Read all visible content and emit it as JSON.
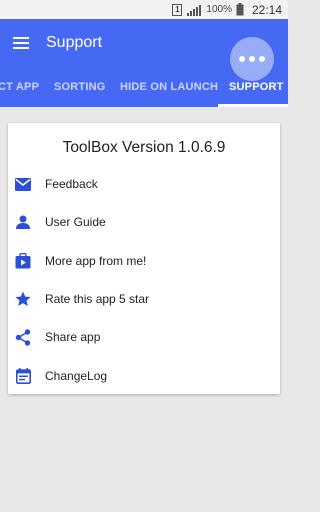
{
  "status_bar": {
    "sim_label": "1",
    "battery": "100%",
    "time": "22:14"
  },
  "app_bar": {
    "title": "Support"
  },
  "tabs": [
    {
      "label": "CT APP"
    },
    {
      "label": "SORTING"
    },
    {
      "label": "HIDE ON LAUNCH"
    },
    {
      "label": "SUPPORT",
      "active": true
    }
  ],
  "card": {
    "title": "ToolBox Version 1.0.6.9",
    "items": [
      {
        "label": "Feedback",
        "icon": "email-icon"
      },
      {
        "label": "User Guide",
        "icon": "person-icon"
      },
      {
        "label": "More app from me!",
        "icon": "store-icon"
      },
      {
        "label": "Rate this app 5 star",
        "icon": "star-icon"
      },
      {
        "label": "Share app",
        "icon": "share-icon"
      },
      {
        "label": "ChangeLog",
        "icon": "calendar-icon"
      }
    ]
  },
  "colors": {
    "primary": "#4569f3",
    "background": "#e8e8e8",
    "icon": "#2b4fd8"
  }
}
